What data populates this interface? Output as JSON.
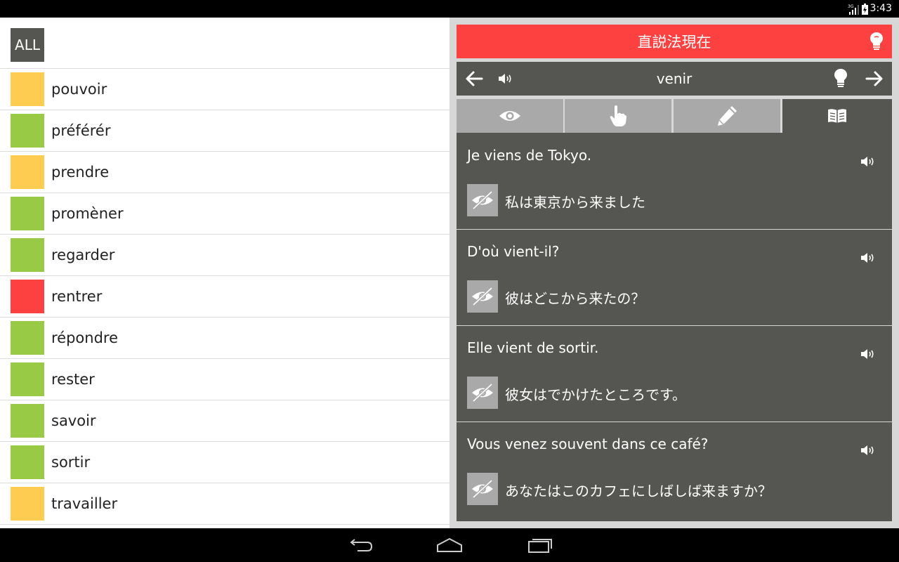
{
  "status_bar": {
    "time": "3:43",
    "icons": [
      "signal-3g-icon",
      "battery-icon"
    ]
  },
  "verb_list": {
    "all_label": "ALL",
    "items": [
      {
        "label": "pouvoir",
        "status_color": "#fecc50"
      },
      {
        "label": "préférér",
        "status_color": "#99ca45"
      },
      {
        "label": "prendre",
        "status_color": "#fecc50"
      },
      {
        "label": "promèner",
        "status_color": "#99ca45"
      },
      {
        "label": "regarder",
        "status_color": "#99ca45"
      },
      {
        "label": "rentrer",
        "status_color": "#fd4040"
      },
      {
        "label": "répondre",
        "status_color": "#99ca45"
      },
      {
        "label": "rester",
        "status_color": "#99ca45"
      },
      {
        "label": "savoir",
        "status_color": "#99ca45"
      },
      {
        "label": "sortir",
        "status_color": "#99ca45"
      },
      {
        "label": "travailler",
        "status_color": "#fecc50"
      }
    ]
  },
  "detail": {
    "title": "直説法現在",
    "title_color": "#fd4040",
    "verb": "venir",
    "tabs": [
      {
        "icon": "eye-icon",
        "active": false
      },
      {
        "icon": "hand-pointer-icon",
        "active": false
      },
      {
        "icon": "pencil-icon",
        "active": false
      },
      {
        "icon": "book-icon",
        "active": true
      }
    ],
    "examples": [
      {
        "french": "Je viens de Tokyo.",
        "japanese": "私は東京から来ました"
      },
      {
        "french": "D'où vient-il?",
        "japanese": "彼はどこから来たの？"
      },
      {
        "french": "Elle vient de sortir.",
        "japanese": "彼女はでかけたところです。"
      },
      {
        "french": "Vous venez souvent dans ce café?",
        "japanese": "あなたはこのカフェにしばしば来ますか？"
      }
    ]
  },
  "nav_bar": {
    "icons": [
      "back-icon",
      "home-icon",
      "recent-apps-icon"
    ]
  }
}
